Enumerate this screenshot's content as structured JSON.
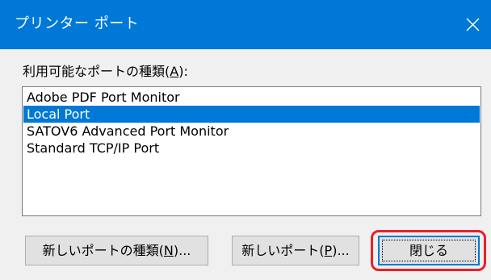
{
  "window": {
    "title": "プリンター ポート",
    "close_icon": "close-icon"
  },
  "port_types": {
    "label_prefix": "利用可能なポートの種類(",
    "label_accel": "A",
    "label_suffix": "):",
    "items": [
      {
        "label": "Adobe PDF Port Monitor",
        "selected": false
      },
      {
        "label": "Local Port",
        "selected": true
      },
      {
        "label": "SATOV6 Advanced Port Monitor",
        "selected": false
      },
      {
        "label": "Standard TCP/IP Port",
        "selected": false
      }
    ]
  },
  "buttons": {
    "new_port_type": {
      "prefix": "新しいポートの種類(",
      "accel": "N",
      "suffix": ")..."
    },
    "new_port": {
      "prefix": "新しいポート(",
      "accel": "P",
      "suffix": ")..."
    },
    "close": {
      "label": "閉じる"
    }
  },
  "colors": {
    "title_bar": "#0078d7",
    "selection": "#0078d7",
    "highlight_annotation": "#e8202a"
  }
}
